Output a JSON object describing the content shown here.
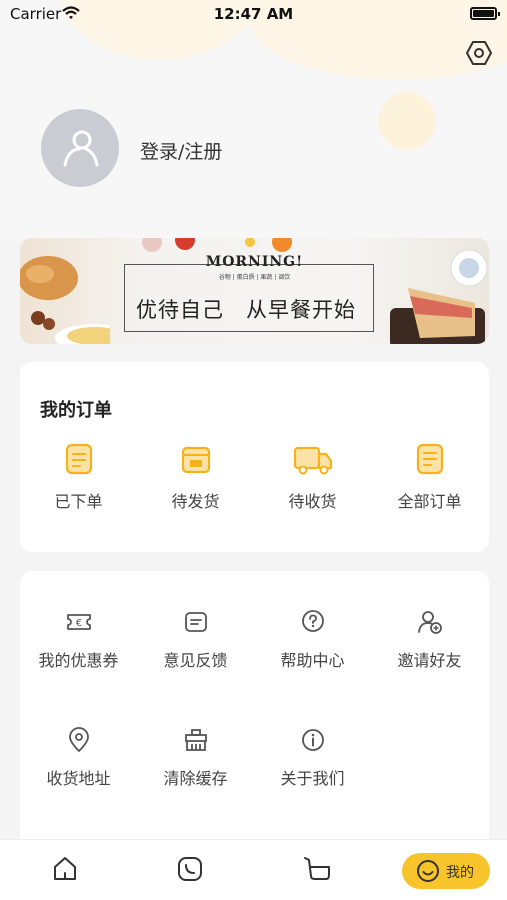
{
  "status_bar": {
    "carrier": "Carrier",
    "time": "12:47 AM"
  },
  "profile": {
    "login_label": "登录/注册"
  },
  "banner": {
    "headline": "MORNING!",
    "subline": "谷物 | 蛋白质 | 果蔬 | 调饮",
    "slogan": "优待自己　从早餐开始"
  },
  "orders": {
    "title": "我的订单",
    "items": [
      {
        "label": "已下单",
        "icon": "order-placed-icon"
      },
      {
        "label": "待发货",
        "icon": "to-ship-icon"
      },
      {
        "label": "待收货",
        "icon": "delivery-truck-icon"
      },
      {
        "label": "全部订单",
        "icon": "all-orders-icon"
      }
    ]
  },
  "services": {
    "items": [
      {
        "label": "我的优惠券",
        "icon": "coupon-icon"
      },
      {
        "label": "意见反馈",
        "icon": "feedback-icon"
      },
      {
        "label": "帮助中心",
        "icon": "help-icon"
      },
      {
        "label": "邀请好友",
        "icon": "invite-friend-icon"
      },
      {
        "label": "收货地址",
        "icon": "location-pin-icon"
      },
      {
        "label": "清除缓存",
        "icon": "clear-cache-icon"
      },
      {
        "label": "关于我们",
        "icon": "info-icon"
      }
    ]
  },
  "tabbar": {
    "active_label": "我的"
  },
  "colors": {
    "accent": "#f8c42b",
    "icon_orange": "#f5b21a",
    "page_bg": "#f4f4f5"
  }
}
